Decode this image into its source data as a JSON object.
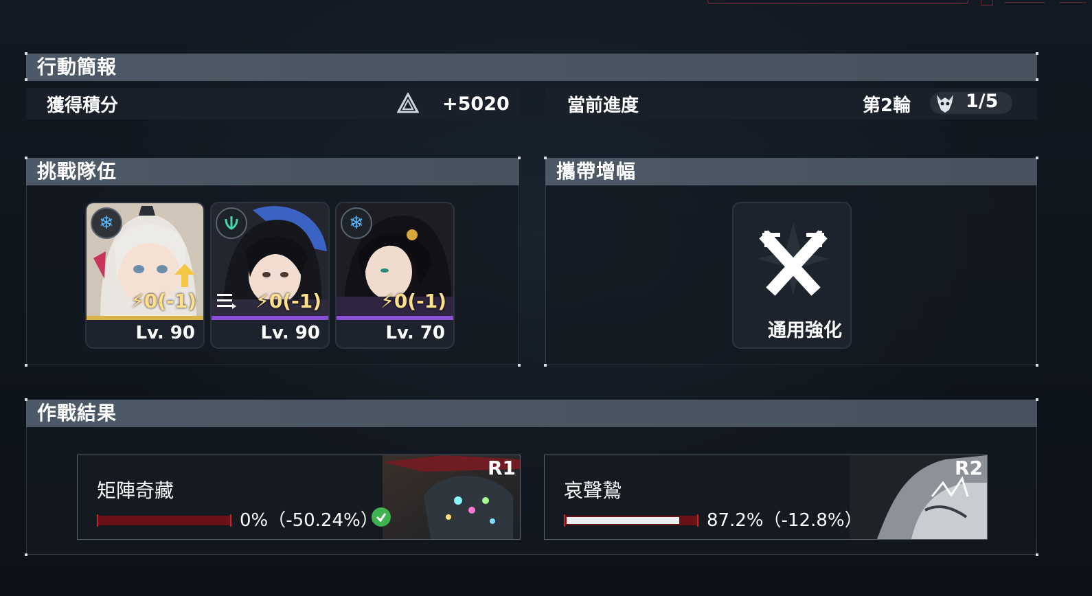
{
  "briefing": {
    "title": "行動簡報",
    "points_label": "獲得積分",
    "points_value": "+5020",
    "progress_label": "當前進度",
    "round_label": "第2輪",
    "stage_progress": "1/5"
  },
  "team": {
    "title": "挑戰隊伍",
    "members": [
      {
        "energy": "0(-1)",
        "level": "Lv. 90",
        "element_icon": "snowflake-icon",
        "rarity_color": "#d9b24a"
      },
      {
        "energy": "0(-1)",
        "level": "Lv. 90",
        "element_icon": "shield-wing-icon",
        "rarity_color": "#8a4fd6"
      },
      {
        "energy": "0(-1)",
        "level": "Lv. 70",
        "element_icon": "snowflake-icon",
        "rarity_color": "#8a4fd6"
      }
    ]
  },
  "boost": {
    "title": "攜帶增幅",
    "item_label": "通用強化",
    "item_icon": "crossed-swords-icon"
  },
  "results": {
    "title": "作戰結果",
    "bosses": [
      {
        "name": "矩陣奇藏",
        "rank": "R1",
        "hp_text": "0%（-50.24%）",
        "hp_fraction": 0.0,
        "cleared": true
      },
      {
        "name": "哀聲鷙",
        "rank": "R2",
        "hp_text": "87.2%（-12.8%）",
        "hp_fraction": 0.872,
        "cleared": false
      }
    ]
  },
  "colors": {
    "header_bg": "#4d5966",
    "hp_loss": "#6a1116",
    "hp_remaining": "#eceff2",
    "check_green": "#3fb34f",
    "energy_yellow": "#ffe08a"
  }
}
